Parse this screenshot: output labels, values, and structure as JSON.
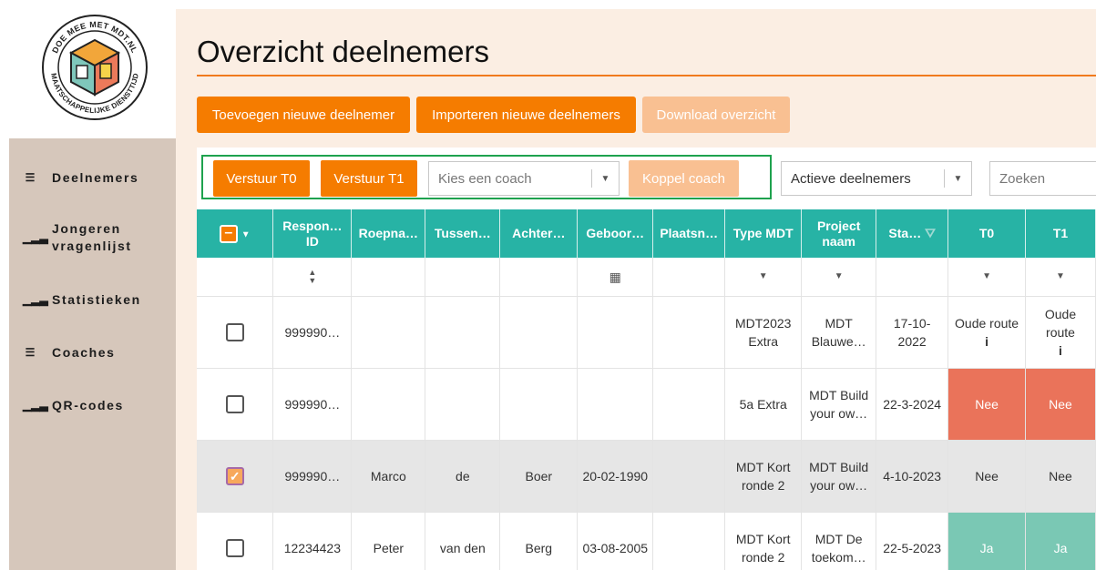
{
  "logo": {
    "top_text": "DOE MEE MET MDT.NL",
    "bottom_text": "MAATSCHAPPELIJKE DIENSTTIJD"
  },
  "sidebar": {
    "items": [
      {
        "icon": "list-icon",
        "label": "Deelnemers"
      },
      {
        "icon": "chart-icon",
        "label": "Jongeren vragenlijst"
      },
      {
        "icon": "chart-icon",
        "label": "Statistieken"
      },
      {
        "icon": "list-icon",
        "label": "Coaches"
      },
      {
        "icon": "chart-icon",
        "label": "QR-codes"
      }
    ]
  },
  "page": {
    "title": "Overzicht deelnemers",
    "actions": {
      "add": "Toevoegen nieuwe deelnemer",
      "import": "Importeren nieuwe deelnemers",
      "download": "Download overzicht"
    }
  },
  "toolbar": {
    "send_t0": "Verstuur T0",
    "send_t1": "Verstuur T1",
    "coach_placeholder": "Kies een coach",
    "link_coach": "Koppel coach",
    "status_filter": "Actieve deelnemers",
    "search_placeholder": "Zoeken"
  },
  "colors": {
    "accent": "#f57c00",
    "header": "#27b3a5",
    "nee": "#ea735a",
    "ja": "#7ac8b4"
  },
  "table": {
    "columns": [
      "Respon… ID",
      "Roepna…",
      "Tussen…",
      "Achter…",
      "Geboor…",
      "Plaatsn…",
      "Type MDT",
      "Project naam",
      "Sta…",
      "T0",
      "T1"
    ],
    "rows": [
      {
        "checked": false,
        "id": "999990…",
        "roepnaam": "",
        "tussen": "",
        "achter": "",
        "geboorte": "",
        "plaats": "",
        "type": "MDT2023 Extra",
        "project": "MDT Blauwe…",
        "start": "17-10-2022",
        "t0": "Oude route",
        "t1": "Oude route"
      },
      {
        "checked": false,
        "id": "999990…",
        "roepnaam": "",
        "tussen": "",
        "achter": "",
        "geboorte": "",
        "plaats": "",
        "type": "5a Extra",
        "project": "MDT Build your ow…",
        "start": "22-3-2024",
        "t0": "Nee",
        "t1": "Nee"
      },
      {
        "checked": true,
        "id": "999990…",
        "roepnaam": "Marco",
        "tussen": "de",
        "achter": "Boer",
        "geboorte": "20-02-1990",
        "plaats": "",
        "type": "MDT Kort ronde 2",
        "project": "MDT Build your ow…",
        "start": "4-10-2023",
        "t0": "Nee",
        "t1": "Nee"
      },
      {
        "checked": false,
        "id": "12234423",
        "roepnaam": "Peter",
        "tussen": "van den",
        "achter": "Berg",
        "geboorte": "03-08-2005",
        "plaats": "",
        "type": "MDT Kort ronde 2",
        "project": "MDT De toekom…",
        "start": "22-5-2023",
        "t0": "Ja",
        "t1": "Ja"
      }
    ]
  }
}
